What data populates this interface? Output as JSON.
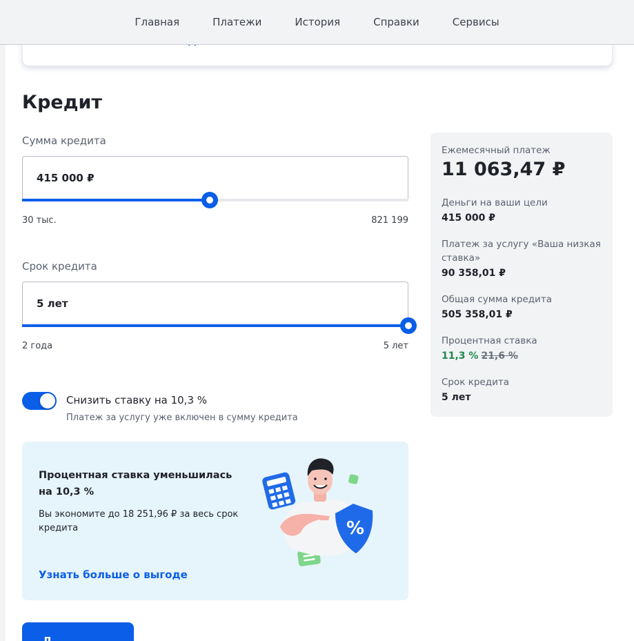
{
  "nav": {
    "items": [
      "Главная",
      "Платежи",
      "История",
      "Справки",
      "Сервисы"
    ]
  },
  "top_card": {
    "link": "Узнать больше о выгоде"
  },
  "section": {
    "title": "Кредит"
  },
  "amount": {
    "label": "Сумма кредита",
    "value": "415 000 ₽",
    "min_label": "30 тыс.",
    "max_label": "821 199",
    "slider_fraction": 0.485
  },
  "term": {
    "label": "Срок кредита",
    "value": "5 лет",
    "min_label": "2 года",
    "max_label": "5 лет",
    "slider_fraction": 1.0
  },
  "toggle": {
    "label": "Снизить ставку на 10,3 %",
    "sub": "Платеж за услугу уже включен в сумму кредита",
    "on": true
  },
  "promo": {
    "title": "Процентная ставка уменьшилась на 10,3 %",
    "text": "Вы экономите до 18 251,96 ₽ за весь срок кредита",
    "link": "Узнать больше о выгоде"
  },
  "cta": {
    "label": "Д"
  },
  "summary": {
    "monthly_label": "Ежемесячный платеж",
    "monthly_value": "11 063,47 ₽",
    "goals_label": "Деньги на ваши цели",
    "goals_value": "415 000 ₽",
    "service_label": "Платеж за услугу «Ваша низкая ставка»",
    "service_value": "90 358,01 ₽",
    "total_label": "Общая сумма кредита",
    "total_value": "505 358,01 ₽",
    "rate_label": "Процентная ставка",
    "rate_new": "11,3 %",
    "rate_old": "21,6 %",
    "term_label": "Срок кредита",
    "term_value": "5 лет"
  },
  "colors": {
    "accent": "#0b5ee8",
    "rate_green": "#1f8a4c",
    "promo_bg": "#e6f4fb"
  }
}
